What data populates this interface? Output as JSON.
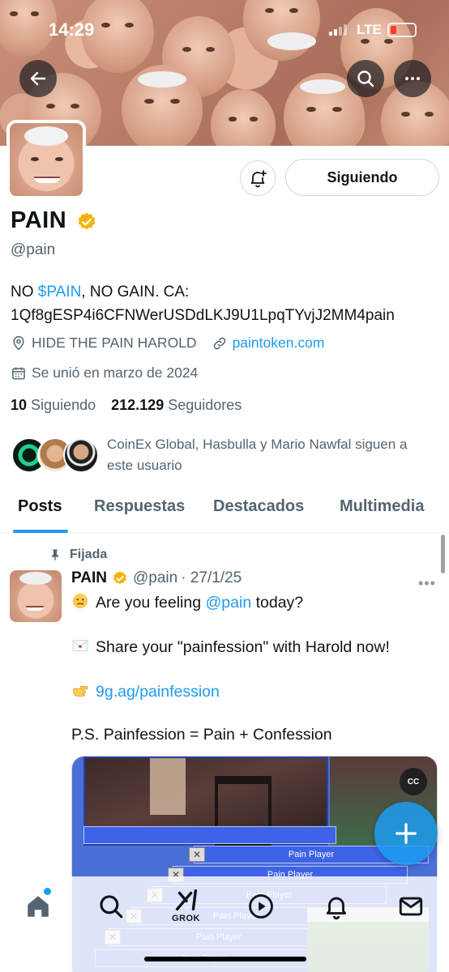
{
  "status_bar": {
    "time": "14:29",
    "network": "LTE"
  },
  "profile": {
    "name": "PAIN",
    "handle": "@pain",
    "bio_prefix": "NO ",
    "bio_link": "$PAIN",
    "bio_suffix": ", NO GAIN. CA:",
    "bio_ca": "1Qf8gESP4i6CFNWerUSDdLKJ9U1LpqTYvjJ2MM4pain",
    "location": "HIDE THE PAIN HAROLD",
    "website": "paintoken.com",
    "joined": "Se unió en marzo de 2024",
    "following_count": "10",
    "following_label": "Siguiendo",
    "followers_count": "212.129",
    "followers_label": "Seguidores",
    "follow_button": "Siguiendo",
    "known_followers_line1": "CoinEx Global, Hasbulla y Mario Nawfal siguen a",
    "known_followers_line2": "este usuario"
  },
  "tabs": [
    "Posts",
    "Respuestas",
    "Destacados",
    "Multimedia"
  ],
  "post": {
    "pinned_label": "Fijada",
    "author": "PAIN",
    "handle": "@pain",
    "date": "· 27/1/25",
    "line1_pre": "Are you feeling ",
    "line1_mention": "@pain",
    "line1_post": " today?",
    "line2": "Share your \"painfession\" with Harold now!",
    "line3_link": "9g.ag/painfession",
    "line4": "P.S. Painfession = Pain + Confession",
    "media_window_title": "Pain Player"
  },
  "nav": {
    "grok_label": "GROK"
  },
  "colors": {
    "accent": "#1d9bf0",
    "verified": "#f4b400",
    "text_secondary": "#536471"
  },
  "icons": [
    "back-arrow-icon",
    "search-icon",
    "more-icon",
    "bell-plus-icon",
    "verified-badge-icon",
    "location-icon",
    "link-icon",
    "calendar-icon",
    "pin-icon",
    "home-icon",
    "grok-icon",
    "play-icon",
    "bell-icon",
    "mail-icon",
    "compose-plus-icon"
  ]
}
